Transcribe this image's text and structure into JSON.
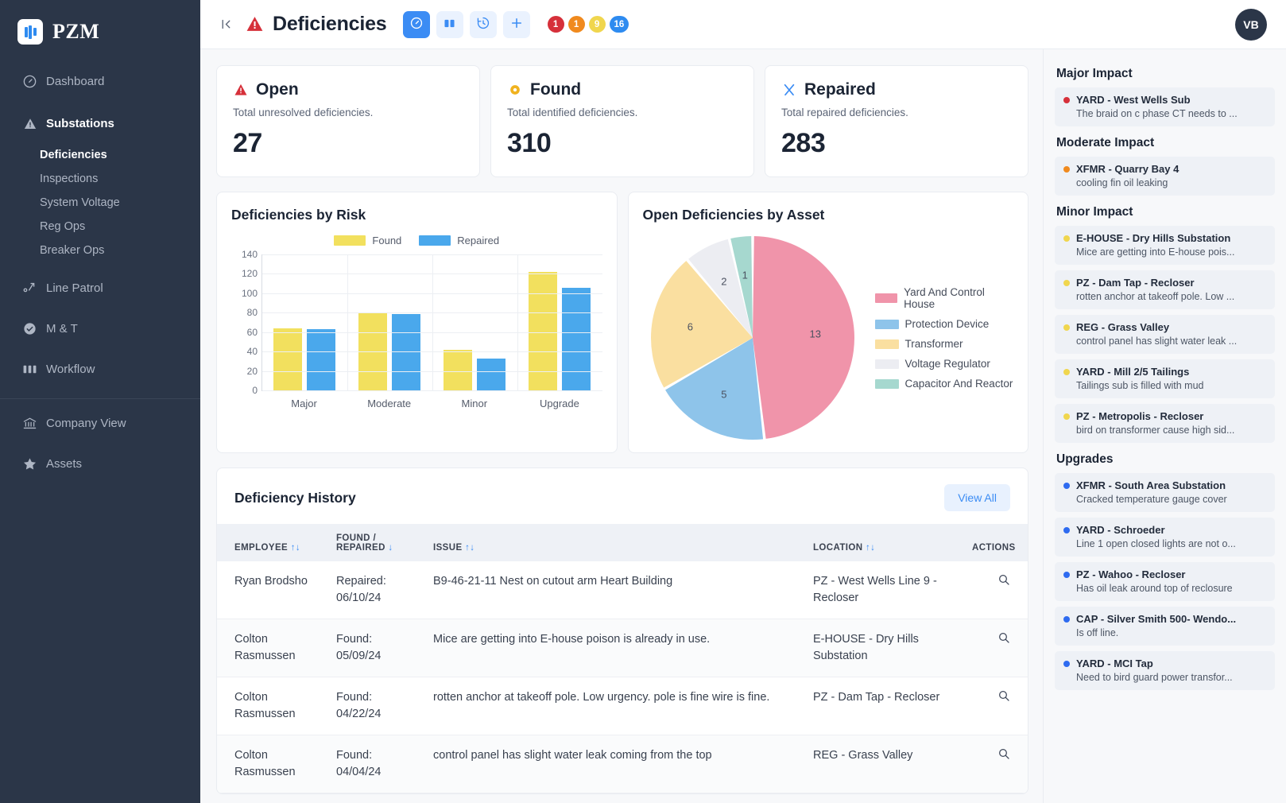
{
  "brand": {
    "name": "PZM",
    "logo_icon": "bar-chart-logo-icon"
  },
  "sidebar": {
    "items": [
      {
        "label": "Dashboard",
        "icon": "gauge-icon"
      },
      {
        "label": "Substations",
        "icon": "warning-triangle-icon"
      },
      {
        "label": "Line Patrol",
        "icon": "route-pin-icon"
      },
      {
        "label": "M & T",
        "icon": "badge-check-icon"
      },
      {
        "label": "Workflow",
        "icon": "columns-icon"
      },
      {
        "label": "Company View",
        "icon": "bank-icon"
      },
      {
        "label": "Assets",
        "icon": "star-icon"
      }
    ],
    "sub_items": [
      {
        "label": "Deficiencies"
      },
      {
        "label": "Inspections"
      },
      {
        "label": "System Voltage"
      },
      {
        "label": "Reg Ops"
      },
      {
        "label": "Breaker Ops"
      }
    ]
  },
  "topbar": {
    "collapse_icon": "collapse-panel-icon",
    "title": "Deficiencies",
    "title_icon": "warning-triangle-icon",
    "tools": [
      {
        "icon": "gauge-icon",
        "active": true
      },
      {
        "icon": "columns-icon",
        "active": false
      },
      {
        "icon": "history-clock-icon",
        "active": false
      },
      {
        "icon": "plus-icon",
        "active": false
      }
    ],
    "badges": [
      {
        "value": "1",
        "color": "#d6303a"
      },
      {
        "value": "1",
        "color": "#f08a1e"
      },
      {
        "value": "9",
        "color": "#f0d64e"
      },
      {
        "value": "16",
        "color": "#2e8bf0"
      }
    ],
    "avatar": "VB"
  },
  "stats": [
    {
      "title": "Open",
      "subtitle": "Total unresolved deficiencies.",
      "value": "27",
      "icon": "warning-triangle-icon",
      "color": "#d6303a"
    },
    {
      "title": "Found",
      "subtitle": "Total identified deficiencies.",
      "value": "310",
      "icon": "circle-marker-icon",
      "color": "#f0b21e"
    },
    {
      "title": "Repaired",
      "subtitle": "Total repaired deficiencies.",
      "value": "283",
      "icon": "wrench-cross-icon",
      "color": "#3b8cf4"
    }
  ],
  "chart_data": [
    {
      "type": "bar",
      "title": "Deficiencies by Risk",
      "categories": [
        "Major",
        "Moderate",
        "Minor",
        "Upgrade"
      ],
      "series": [
        {
          "name": "Found",
          "values": [
            64,
            80,
            42,
            122
          ],
          "color": "#f2e05e"
        },
        {
          "name": "Repaired",
          "values": [
            63,
            79,
            33,
            106
          ],
          "color": "#4aa8ec"
        }
      ],
      "xlabel": "",
      "ylabel": "",
      "ylim": [
        0,
        140
      ],
      "yticks": [
        0,
        20,
        40,
        60,
        80,
        100,
        120,
        140
      ],
      "grid": true,
      "legend_position": "top-center"
    },
    {
      "type": "pie",
      "title": "Open Deficiencies by Asset",
      "labels": [
        "Yard And Control House",
        "Protection Device",
        "Transformer",
        "Voltage Regulator",
        "Capacitor And Reactor"
      ],
      "values": [
        13,
        5,
        6,
        2,
        1
      ],
      "colors": [
        "#f094aa",
        "#8ec4ea",
        "#fadfa0",
        "#ecedf2",
        "#a6d8cf"
      ],
      "legend_position": "right",
      "total": 27
    }
  ],
  "table": {
    "title": "Deficiency History",
    "view_all_label": "View All",
    "columns": [
      {
        "label": "EMPLOYEE",
        "sorts": "↑↓"
      },
      {
        "label": "FOUND / REPAIRED",
        "sorts": "↓"
      },
      {
        "label": "ISSUE",
        "sorts": "↑↓"
      },
      {
        "label": "LOCATION",
        "sorts": "↑↓"
      },
      {
        "label": "ACTIONS",
        "sorts": ""
      }
    ],
    "rows": [
      {
        "employee": "Ryan Brodsho",
        "date": "Repaired: 06/10/24",
        "issue": "B9-46-21-11 Nest on cutout arm Heart Building",
        "location": "PZ - West Wells Line 9 - Recloser",
        "action_icon": "magnifier-icon"
      },
      {
        "employee": "Colton Rasmussen",
        "date": "Found: 05/09/24",
        "issue": "Mice are getting into E-house poison is already in use.",
        "location": "E-HOUSE - Dry Hills Substation",
        "action_icon": "magnifier-icon"
      },
      {
        "employee": "Colton Rasmussen",
        "date": "Found: 04/22/24",
        "issue": "rotten anchor at takeoff pole. Low urgency. pole is fine wire is fine.",
        "location": "PZ - Dam Tap - Recloser",
        "action_icon": "magnifier-icon"
      },
      {
        "employee": "Colton Rasmussen",
        "date": "Found: 04/04/24",
        "issue": "control panel has slight water leak coming from the top",
        "location": "REG - Grass Valley",
        "action_icon": "magnifier-icon"
      }
    ]
  },
  "rail": {
    "groups": [
      {
        "title": "Major Impact",
        "items": [
          {
            "title": "YARD - West Wells Sub",
            "desc": "The braid on c phase CT needs to ...",
            "color": "#d6303a"
          }
        ]
      },
      {
        "title": "Moderate Impact",
        "items": [
          {
            "title": "XFMR - Quarry Bay 4",
            "desc": "cooling fin oil leaking",
            "color": "#f08a1e"
          }
        ]
      },
      {
        "title": "Minor Impact",
        "items": [
          {
            "title": "E-HOUSE - Dry Hills Substation",
            "desc": "Mice are getting into E-house pois...",
            "color": "#f0d64e"
          },
          {
            "title": "PZ - Dam Tap - Recloser",
            "desc": "rotten anchor at takeoff pole. Low ...",
            "color": "#f0d64e"
          },
          {
            "title": "REG - Grass Valley",
            "desc": "control panel has slight water leak ...",
            "color": "#f0d64e"
          },
          {
            "title": "YARD - Mill 2/5 Tailings",
            "desc": "Tailings sub is filled with mud",
            "color": "#f0d64e"
          },
          {
            "title": "PZ - Metropolis - Recloser",
            "desc": "bird on transformer cause high sid...",
            "color": "#f0d64e"
          }
        ]
      },
      {
        "title": "Upgrades",
        "items": [
          {
            "title": "XFMR - South Area Substation",
            "desc": "Cracked temperature gauge cover",
            "color": "#2e6bf0"
          },
          {
            "title": "YARD - Schroeder",
            "desc": "Line 1 open closed lights are not o...",
            "color": "#2e6bf0"
          },
          {
            "title": "PZ - Wahoo - Recloser",
            "desc": "Has oil leak around top of reclosure",
            "color": "#2e6bf0"
          },
          {
            "title": "CAP - Silver Smith 500- Wendo...",
            "desc": "Is off line.",
            "color": "#2e6bf0"
          },
          {
            "title": "YARD - MCI Tap",
            "desc": "Need to bird guard power transfor...",
            "color": "#2e6bf0"
          }
        ]
      }
    ]
  }
}
